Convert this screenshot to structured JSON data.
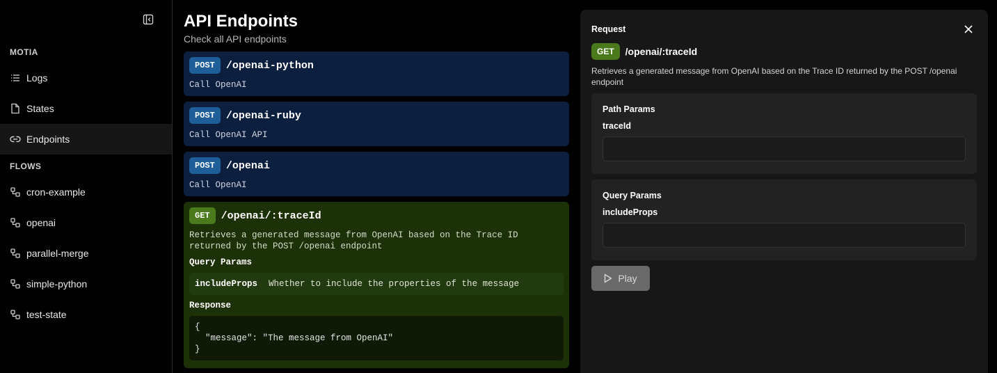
{
  "sidebar": {
    "motia_label": "MOTIA",
    "nav": [
      {
        "label": "Logs",
        "icon": "list-icon"
      },
      {
        "label": "States",
        "icon": "file-icon"
      },
      {
        "label": "Endpoints",
        "icon": "link-icon",
        "active": true
      }
    ],
    "flows_label": "FLOWS",
    "flows": [
      {
        "label": "cron-example",
        "icon": "workflow-icon"
      },
      {
        "label": "openai",
        "icon": "workflow-icon"
      },
      {
        "label": "parallel-merge",
        "icon": "workflow-icon"
      },
      {
        "label": "simple-python",
        "icon": "workflow-icon"
      },
      {
        "label": "test-state",
        "icon": "workflow-icon"
      }
    ]
  },
  "main": {
    "title": "API Endpoints",
    "subtitle": "Check all API endpoints",
    "endpoints": [
      {
        "method": "POST",
        "path": "/openai-python",
        "description": "Call OpenAI"
      },
      {
        "method": "POST",
        "path": "/openai-ruby",
        "description": "Call OpenAI API"
      },
      {
        "method": "POST",
        "path": "/openai",
        "description": "Call OpenAI"
      },
      {
        "method": "GET",
        "path": "/openai/:traceId",
        "description": "Retrieves a generated message from OpenAI based on the Trace ID returned by the POST /openai endpoint",
        "query_params_label": "Query Params",
        "query_params": [
          {
            "name": "includeProps",
            "description": "Whether to include the properties of the message"
          }
        ],
        "response_label": "Response",
        "response_body": "{\n  \"message\": \"The message from OpenAI\"\n}"
      }
    ]
  },
  "panel": {
    "title": "Request",
    "method": "GET",
    "path": "/openai/:traceId",
    "description": "Retrieves a generated message from OpenAI based on the Trace ID returned by the POST /openai endpoint",
    "path_params_label": "Path Params",
    "path_param_name": "traceId",
    "path_param_value": "",
    "query_params_label": "Query Params",
    "query_param_name": "includeProps",
    "query_param_value": "",
    "play_label": "Play"
  },
  "colors": {
    "post_card": "#0d1f3e",
    "get_card": "#1c3108",
    "post_badge": "#1f5f99",
    "get_badge": "#4a7a1c"
  }
}
